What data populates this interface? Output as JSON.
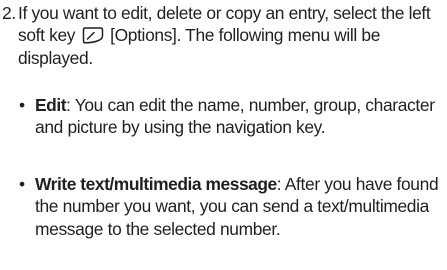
{
  "step": {
    "number": "2.",
    "text_before_icon": "If you want to edit, delete or copy an entry, select the left soft key ",
    "icon": "left-soft-key-icon",
    "text_after_icon": " [Options]. The following menu will be displayed."
  },
  "options": [
    {
      "bullet": "•",
      "term": "Edit",
      "description": ": You can edit the name, number, group, character and picture by using the navigation key."
    },
    {
      "bullet": "•",
      "term": "Write text/multimedia message",
      "description": ": After you have found the number you want, you can send a text/multimedia message to the selected number."
    }
  ]
}
